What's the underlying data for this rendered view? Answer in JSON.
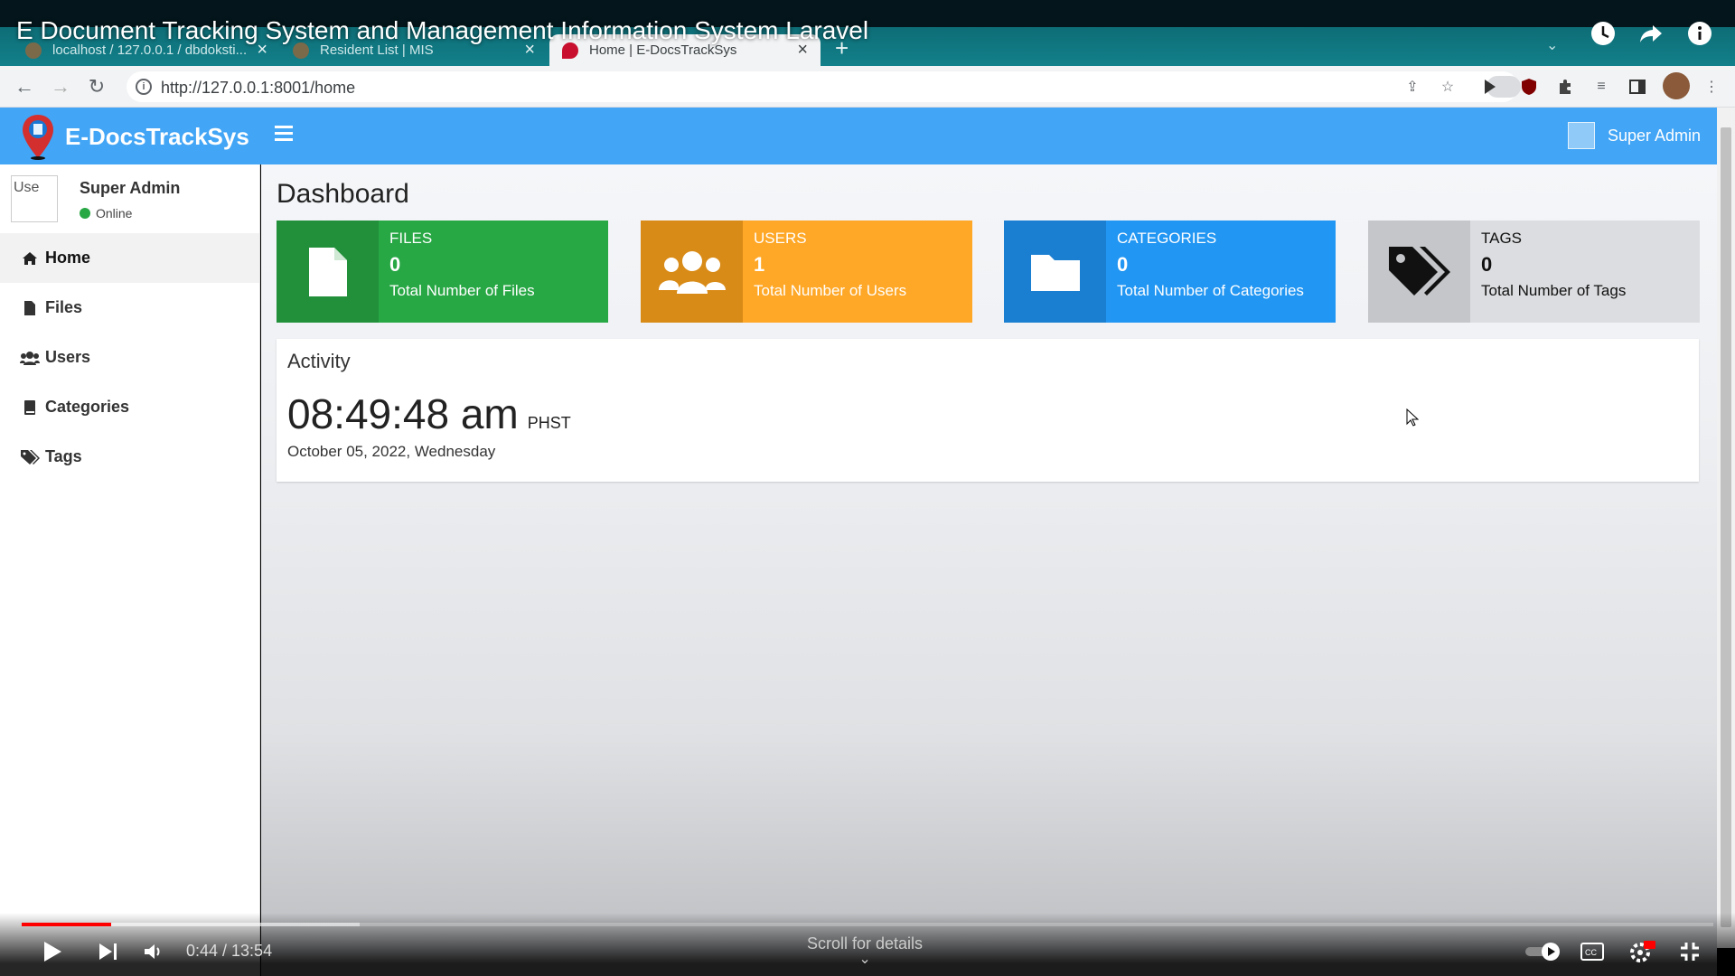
{
  "video": {
    "title": "E Document Tracking System and Management Information System Laravel",
    "time": "0:44 / 13:54",
    "progress_played": 0.053,
    "progress_buffered": 0.2,
    "scroll_hint": "Scroll for details"
  },
  "browser": {
    "tabs": [
      {
        "label": "localhost / 127.0.0.1 / dbdoksti..."
      },
      {
        "label": "Resident List | MIS"
      },
      {
        "label": "Home | E-DocsTrackSys"
      }
    ],
    "url": "http://127.0.0.1:8001/home"
  },
  "app": {
    "brand": "E-DocsTrackSys",
    "header_user": "Super Admin",
    "accent": "#42a5f5"
  },
  "sidebar": {
    "user_name": "Super Admin",
    "user_status": "Online",
    "avatar_alt": "Use",
    "items": [
      {
        "label": "Home",
        "icon": "home-icon"
      },
      {
        "label": "Files",
        "icon": "file-icon"
      },
      {
        "label": "Users",
        "icon": "users-icon"
      },
      {
        "label": "Categories",
        "icon": "book-icon"
      },
      {
        "label": "Tags",
        "icon": "tags-icon"
      }
    ]
  },
  "dashboard": {
    "title": "Dashboard",
    "boxes": [
      {
        "label": "FILES",
        "value": "0",
        "desc": "Total Number of Files",
        "color": "#28a745"
      },
      {
        "label": "USERS",
        "value": "1",
        "desc": "Total Number of Users",
        "color": "#ffa726"
      },
      {
        "label": "CATEGORIES",
        "value": "0",
        "desc": "Total Number of Categories",
        "color": "#2196f3"
      },
      {
        "label": "TAGS",
        "value": "0",
        "desc": "Total Number of Tags",
        "color": "#dcdde0"
      }
    ]
  },
  "activity": {
    "title": "Activity",
    "time": "08:49:48 am",
    "timezone": "PHST",
    "date": "October 05, 2022, Wednesday"
  }
}
